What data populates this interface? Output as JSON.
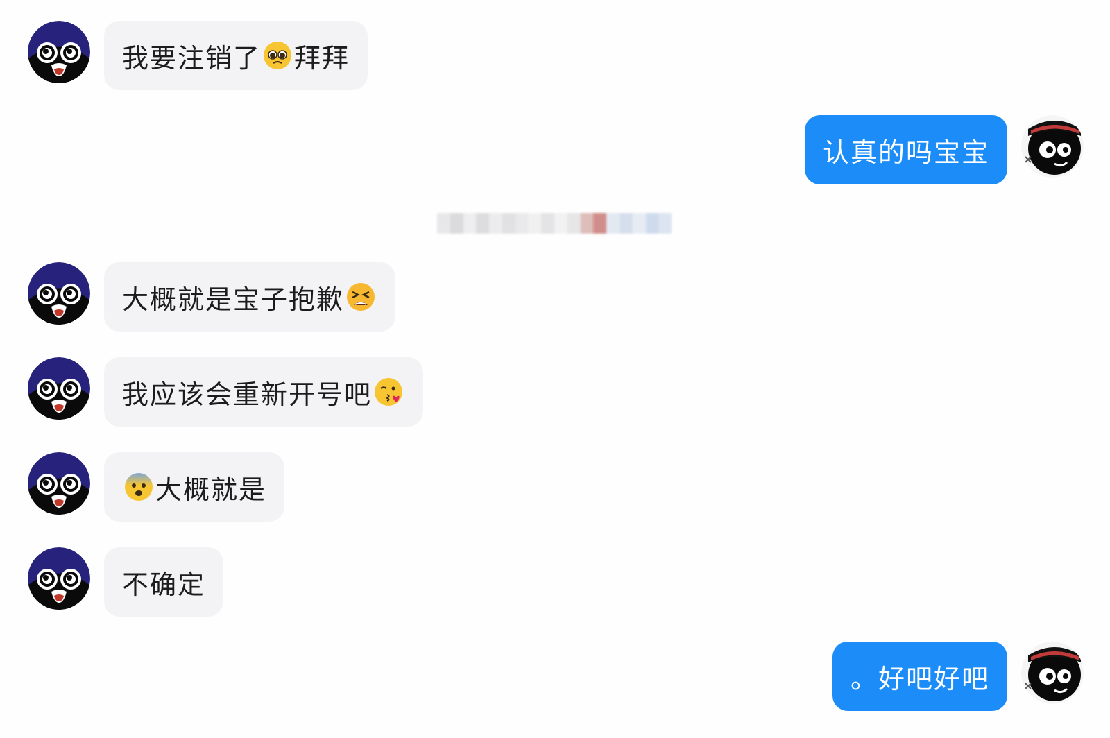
{
  "conversation": {
    "messages": [
      {
        "side": "left",
        "text_before": "我要注销了",
        "emoji": "pleading-face",
        "text_after": "拜拜"
      },
      {
        "side": "right",
        "text_before": "认真的吗宝宝"
      },
      {
        "side": "left",
        "text_before": "大概就是宝子抱歉",
        "emoji": "tired-face"
      },
      {
        "side": "left",
        "text_before": "我应该会重新开号吧",
        "emoji": "face-blowing-kiss"
      },
      {
        "side": "left",
        "text_before": "",
        "emoji": "fearful-face",
        "text_after": "大概就是"
      },
      {
        "side": "left",
        "text_before": "不确定"
      },
      {
        "side": "right",
        "text_before": "。好吧好吧"
      }
    ]
  },
  "colors": {
    "incoming_bubble": "#f3f3f5",
    "outgoing_bubble": "#1b8cf8",
    "text": "#1c1c1c"
  }
}
